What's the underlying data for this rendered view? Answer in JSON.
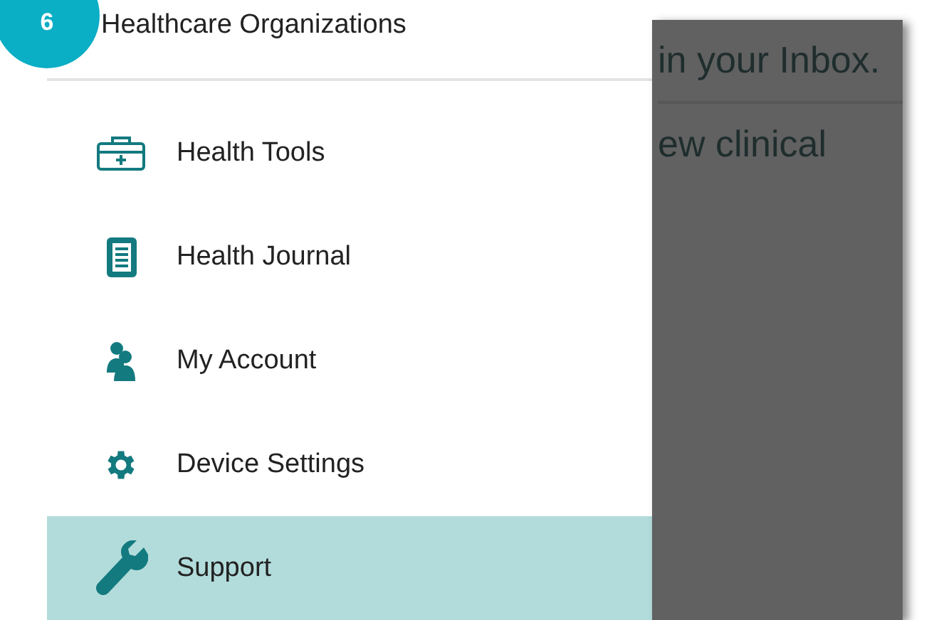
{
  "step_badge": "6",
  "drawer": {
    "header": "Healthcare Organizations",
    "items": [
      {
        "label": "Health Tools",
        "selected": false
      },
      {
        "label": "Health Journal",
        "selected": false
      },
      {
        "label": "My Account",
        "selected": false
      },
      {
        "label": "Device Settings",
        "selected": false
      },
      {
        "label": "Support",
        "selected": true
      }
    ]
  },
  "background": {
    "lines": [
      "in your Inbox.",
      "ew clinical"
    ]
  }
}
